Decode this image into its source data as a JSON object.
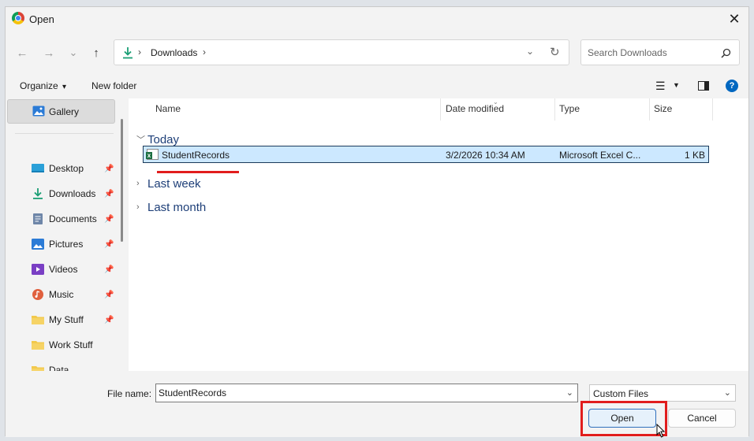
{
  "window": {
    "title": "Open",
    "close_glyph": "✕"
  },
  "nav": {
    "back_glyph": "←",
    "forward_glyph": "→",
    "recent_glyph": "⌄",
    "up_glyph": "↑",
    "breadcrumb": "Downloads",
    "search_placeholder": "Search Downloads"
  },
  "toolbar": {
    "organize_label": "Organize",
    "organize_caret": "▾",
    "new_folder_label": "New folder",
    "help_label": "?"
  },
  "sidebar": {
    "gallery": "Gallery",
    "items": [
      {
        "label": "Desktop",
        "icon": "desktop-icon",
        "pinned": true
      },
      {
        "label": "Downloads",
        "icon": "download-icon",
        "pinned": true
      },
      {
        "label": "Documents",
        "icon": "documents-icon",
        "pinned": true
      },
      {
        "label": "Pictures",
        "icon": "pictures-icon",
        "pinned": true
      },
      {
        "label": "Videos",
        "icon": "videos-icon",
        "pinned": true
      },
      {
        "label": "Music",
        "icon": "music-icon",
        "pinned": true
      },
      {
        "label": "My Stuff",
        "icon": "folder-icon",
        "pinned": true
      },
      {
        "label": "Work Stuff",
        "icon": "folder-icon",
        "pinned": false
      },
      {
        "label": "Data",
        "icon": "folder-icon",
        "pinned": false
      }
    ]
  },
  "columns": {
    "name": "Name",
    "date": "Date modified",
    "type": "Type",
    "size": "Size"
  },
  "groups": {
    "today": "Today",
    "last_week": "Last week",
    "last_month": "Last month"
  },
  "file": {
    "name": "StudentRecords",
    "date": "3/2/2026 10:34 AM",
    "type": "Microsoft Excel C...",
    "size": "1 KB"
  },
  "footer": {
    "file_name_label": "File name:",
    "file_name_value": "StudentRecords",
    "filter_value": "Custom Files",
    "open_label": "Open",
    "cancel_label": "Cancel"
  },
  "colors": {
    "accent": "#0067c0",
    "highlight": "#e11d1d",
    "selection": "#cce8ff"
  }
}
